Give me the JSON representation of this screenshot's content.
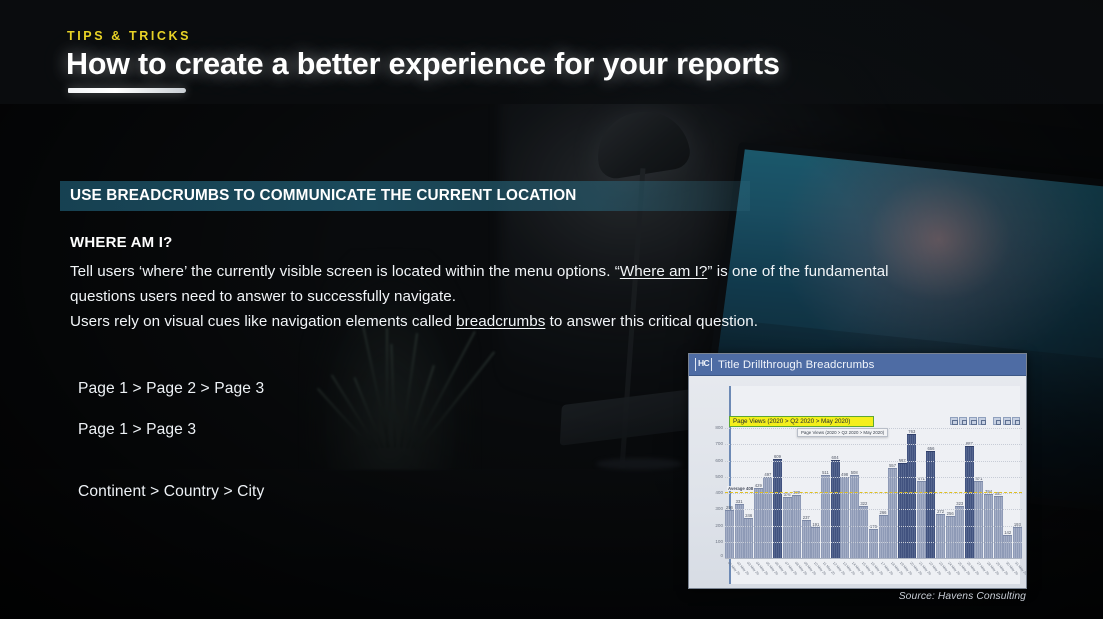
{
  "header": {
    "kicker": "TIPS & TRICKS",
    "title": "How to create a better experience for your reports"
  },
  "banner": {
    "label": "USE BREADCRUMBS TO COMMUNICATE THE CURRENT LOCATION"
  },
  "content": {
    "subhead": "WHERE AM I?",
    "paragraph_part1": "Tell users ‘where’ the currently visible screen is located within the menu options. “",
    "paragraph_link1": "Where am I?",
    "paragraph_part2": "” is one of the fundamental questions users need to answer to successfully navigate.",
    "paragraph_part3": "Users rely on visual cues like navigation elements called ",
    "paragraph_link2": "breadcrumbs",
    "paragraph_part4": " to answer this critical question."
  },
  "examples": {
    "crumb1": "Page 1 > Page 2 > Page 3",
    "crumb2": "Page 1 > Page 3",
    "crumb3": "Continent > Country > City"
  },
  "report": {
    "logo": "HC",
    "title": "Title Drillthrough Breadcrumbs",
    "breadcrumb": "Page Views (2020 > Q2 2020 > May 2020)",
    "tooltip": "Page Views (2020 > Q2 2020 > May 2020)",
    "icon_names": [
      "pin-icon",
      "filter-icon",
      "focus-icon",
      "more-icon",
      "spotlight-icon",
      "fit-icon",
      "expand-icon"
    ]
  },
  "footer": {
    "source": "Source: Havens Consulting"
  },
  "chart_data": {
    "type": "bar",
    "title": "Page Views (2020 > Q2 2020 > May 2020)",
    "xlabel": "",
    "ylabel": "",
    "ylim": [
      0,
      800
    ],
    "yticks": [
      800,
      700,
      600,
      500,
      400,
      300,
      200,
      100,
      0
    ],
    "grid": true,
    "legend": "none",
    "average": 408,
    "average_label": "Average 408",
    "highlight_color": "#41527f",
    "base_color": "#8e9ab6",
    "average_line_color": "#e0c020",
    "categories": [
      "01 May 20",
      "02 May 20",
      "03 May 20",
      "04 May 20",
      "05 May 20",
      "06 May 20",
      "07 May 20",
      "08 May 20",
      "09 May 20",
      "10 May 20",
      "11 May 20",
      "12 May 20",
      "13 May 20",
      "14 May 20",
      "15 May 20",
      "16 May 20",
      "17 May 20",
      "18 May 20",
      "19 May 20",
      "20 May 20",
      "21 May 20",
      "22 May 20",
      "23 May 20",
      "24 May 20",
      "25 May 20",
      "26 May 20",
      "27 May 20",
      "28 May 20",
      "29 May 20",
      "30 May 20",
      "31 May 20"
    ],
    "values": [
      296,
      331,
      246,
      429,
      497,
      609,
      376,
      389,
      237,
      191,
      511,
      604,
      498,
      508,
      322,
      176,
      266,
      557,
      587,
      763,
      471,
      656,
      272,
      256,
      323,
      687,
      471,
      394,
      380,
      142,
      193
    ],
    "highlighted_indices": [
      5,
      11,
      18,
      19,
      21,
      25
    ]
  }
}
